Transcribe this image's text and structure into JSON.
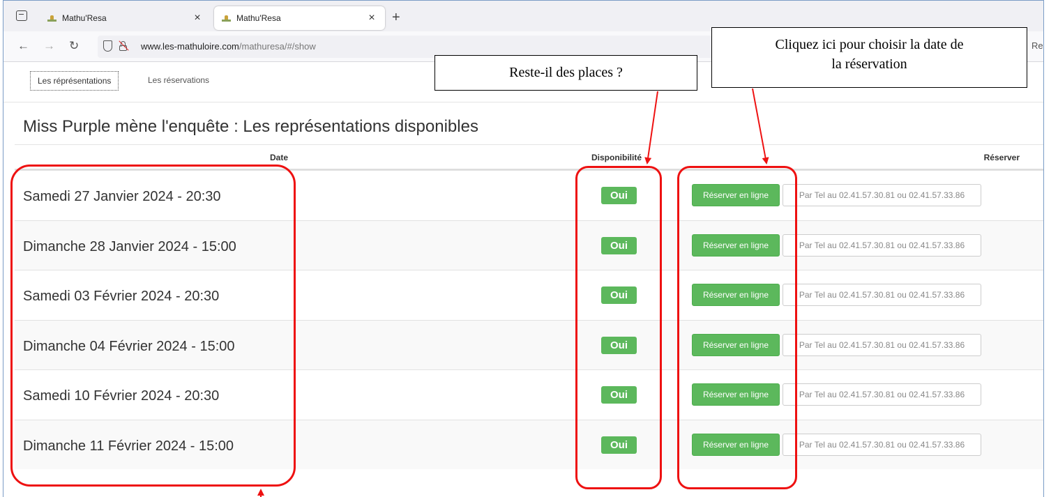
{
  "browser": {
    "tabs": [
      {
        "title": "Mathu'Resa",
        "active": false
      },
      {
        "title": "Mathu'Resa",
        "active": true
      }
    ],
    "new_tab_icon": "plus-icon",
    "url_host": "www.les-mathuloire.com",
    "url_path": "/mathuresa/#/show",
    "right_cut_text": "Re"
  },
  "page": {
    "tabs": [
      "Les réprésentations",
      "Les réservations"
    ],
    "title": "Miss Purple mène l'enquête : Les représentations disponibles"
  },
  "table": {
    "headers": {
      "date": "Date",
      "disponibilite": "Disponibilité",
      "reserver": "Réserver"
    },
    "rows": [
      {
        "date": "Samedi 27 Janvier 2024 - 20:30",
        "available": "Oui",
        "book_label": "Réserver en ligne",
        "phone_label": "Par Tel au 02.41.57.30.81 ou 02.41.57.33.86"
      },
      {
        "date": "Dimanche 28 Janvier 2024 - 15:00",
        "available": "Oui",
        "book_label": "Réserver en ligne",
        "phone_label": "Par Tel au 02.41.57.30.81 ou 02.41.57.33.86"
      },
      {
        "date": "Samedi 03 Février 2024 - 20:30",
        "available": "Oui",
        "book_label": "Réserver en ligne",
        "phone_label": "Par Tel au 02.41.57.30.81 ou 02.41.57.33.86"
      },
      {
        "date": "Dimanche 04 Février 2024 - 15:00",
        "available": "Oui",
        "book_label": "Réserver en ligne",
        "phone_label": "Par Tel au 02.41.57.30.81 ou 02.41.57.33.86"
      },
      {
        "date": "Samedi 10 Février 2024 - 20:30",
        "available": "Oui",
        "book_label": "Réserver en ligne",
        "phone_label": "Par Tel au 02.41.57.30.81 ou 02.41.57.33.86"
      },
      {
        "date": "Dimanche 11 Février 2024 - 15:00",
        "available": "Oui",
        "book_label": "Réserver en ligne",
        "phone_label": "Par Tel au 02.41.57.30.81 ou 02.41.57.33.86"
      }
    ]
  },
  "annotations": {
    "callout_places": "Reste-il des places ?",
    "callout_date_line1": "Cliquez ici pour choisir la date de",
    "callout_date_line2": "la réservation"
  },
  "colors": {
    "success_green": "#5cb85c",
    "annotation_red": "#ee1111",
    "frame_blue": "#7a9cc6"
  }
}
